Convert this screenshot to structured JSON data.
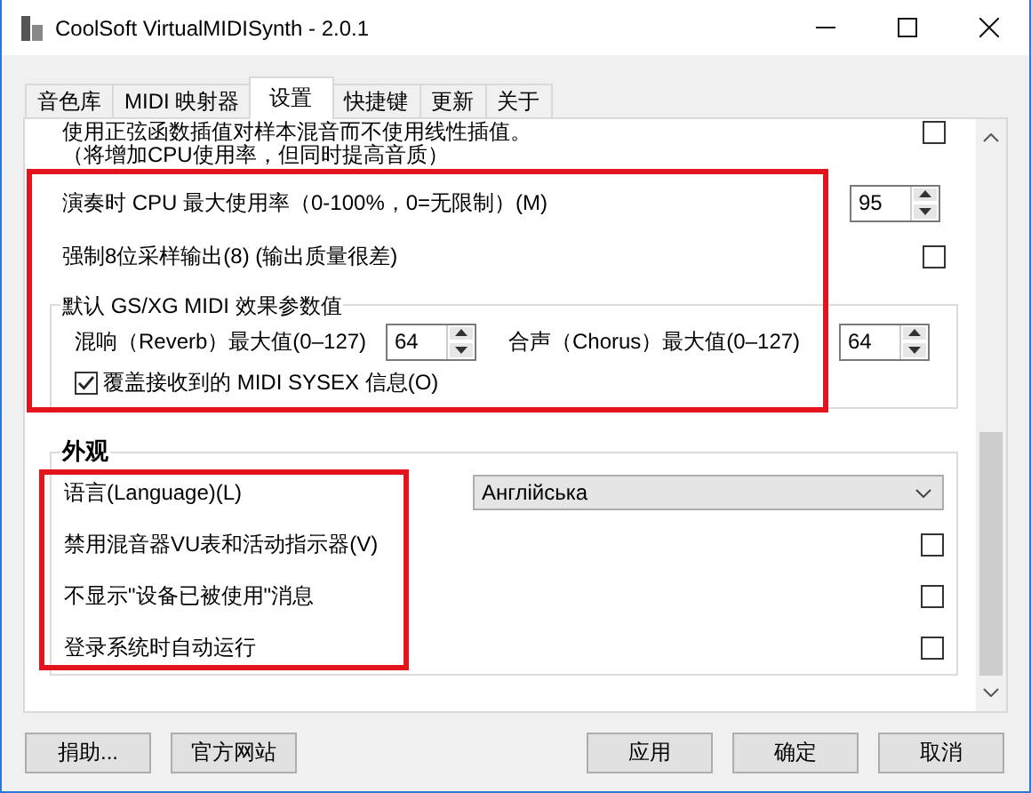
{
  "window": {
    "title": "CoolSoft VirtualMIDISynth - 2.0.1"
  },
  "tabs": [
    {
      "label": "音色库",
      "selected": false
    },
    {
      "label": "MIDI 映射器",
      "selected": false
    },
    {
      "label": "设置",
      "selected": true
    },
    {
      "label": "快捷键",
      "selected": false
    },
    {
      "label": "更新",
      "selected": false
    },
    {
      "label": "关于",
      "selected": false
    }
  ],
  "sections": [
    {
      "kind": "plain",
      "items": [
        {
          "kind": "checkbox",
          "label": "使用正弦函数插值对样本混音而不使用线性插值。",
          "note": "（将增加CPU使用率，但同时提高音质）",
          "checked": false
        }
      ]
    },
    {
      "kind": "framed",
      "items": [
        {
          "kind": "spin",
          "label": "演奏时 CPU 最大使用率（0-100%，0=无限制）(M)",
          "value": "95"
        },
        {
          "kind": "checkbox",
          "label": "强制8位采样输出(8) (输出质量很差)",
          "checked": false
        },
        {
          "kind": "group",
          "title": "默认 GS/XG MIDI 效果参数值",
          "spins": [
            {
              "label": "混响（Reverb）最大值(0–127)",
              "value": "64"
            },
            {
              "label": "合声（Chorus）最大值(0–127)",
              "value": "64"
            }
          ],
          "option": {
            "label": "覆盖接收到的 MIDI SYSEX 信息(O)",
            "checked": true
          }
        }
      ]
    },
    {
      "kind": "framed_labels",
      "title": "外观",
      "items": [
        {
          "kind": "dropdown",
          "label": "语言(Language)(L)",
          "value": "Англійська"
        },
        {
          "kind": "checkbox",
          "label": "禁用混音器VU表和活动指示器(V)",
          "checked": false
        },
        {
          "kind": "checkbox",
          "label": "不显示\"设备已被使用\"消息",
          "checked": false
        },
        {
          "kind": "checkbox",
          "label": "登录系统时自动运行",
          "checked": false
        }
      ]
    }
  ],
  "buttons_left": [
    "捐助...",
    "官方网站"
  ],
  "buttons_right": [
    "应用",
    "确定",
    "取消"
  ]
}
